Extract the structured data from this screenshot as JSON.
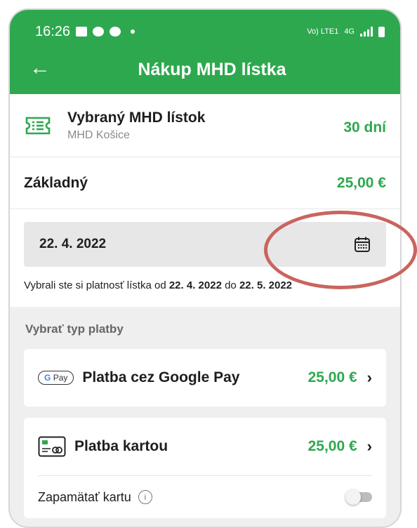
{
  "status_bar": {
    "time": "16:26",
    "network_label": "Vo) LTE1",
    "network_type": "4G"
  },
  "app_bar": {
    "back_icon": "back-arrow-icon",
    "title": "Nákup MHD lístka"
  },
  "ticket": {
    "icon": "ticket-icon",
    "title": "Vybraný MHD lístok",
    "subtitle": "MHD Košice",
    "duration": "30 dní"
  },
  "plan": {
    "name": "Základný",
    "price": "25,00 €"
  },
  "date_picker": {
    "value": "22. 4. 2022",
    "icon": "calendar-icon"
  },
  "validity": {
    "prefix": "Vybrali ste si platnosť lístka od ",
    "from": "22. 4. 2022",
    "middle": " do ",
    "to": "22. 5. 2022"
  },
  "payment_section": {
    "label": "Vybrať typ platby",
    "google_pay": {
      "badge_g": "G",
      "badge_text": "Pay",
      "label": "Platba cez Google Pay",
      "amount": "25,00 €"
    },
    "card": {
      "icon": "credit-card-icon",
      "label": "Platba kartou",
      "amount": "25,00 €",
      "remember_label": "Zapamätať kartu",
      "remember_enabled": false
    }
  },
  "colors": {
    "primary": "#2ea84f",
    "highlight": "#c9655e"
  }
}
